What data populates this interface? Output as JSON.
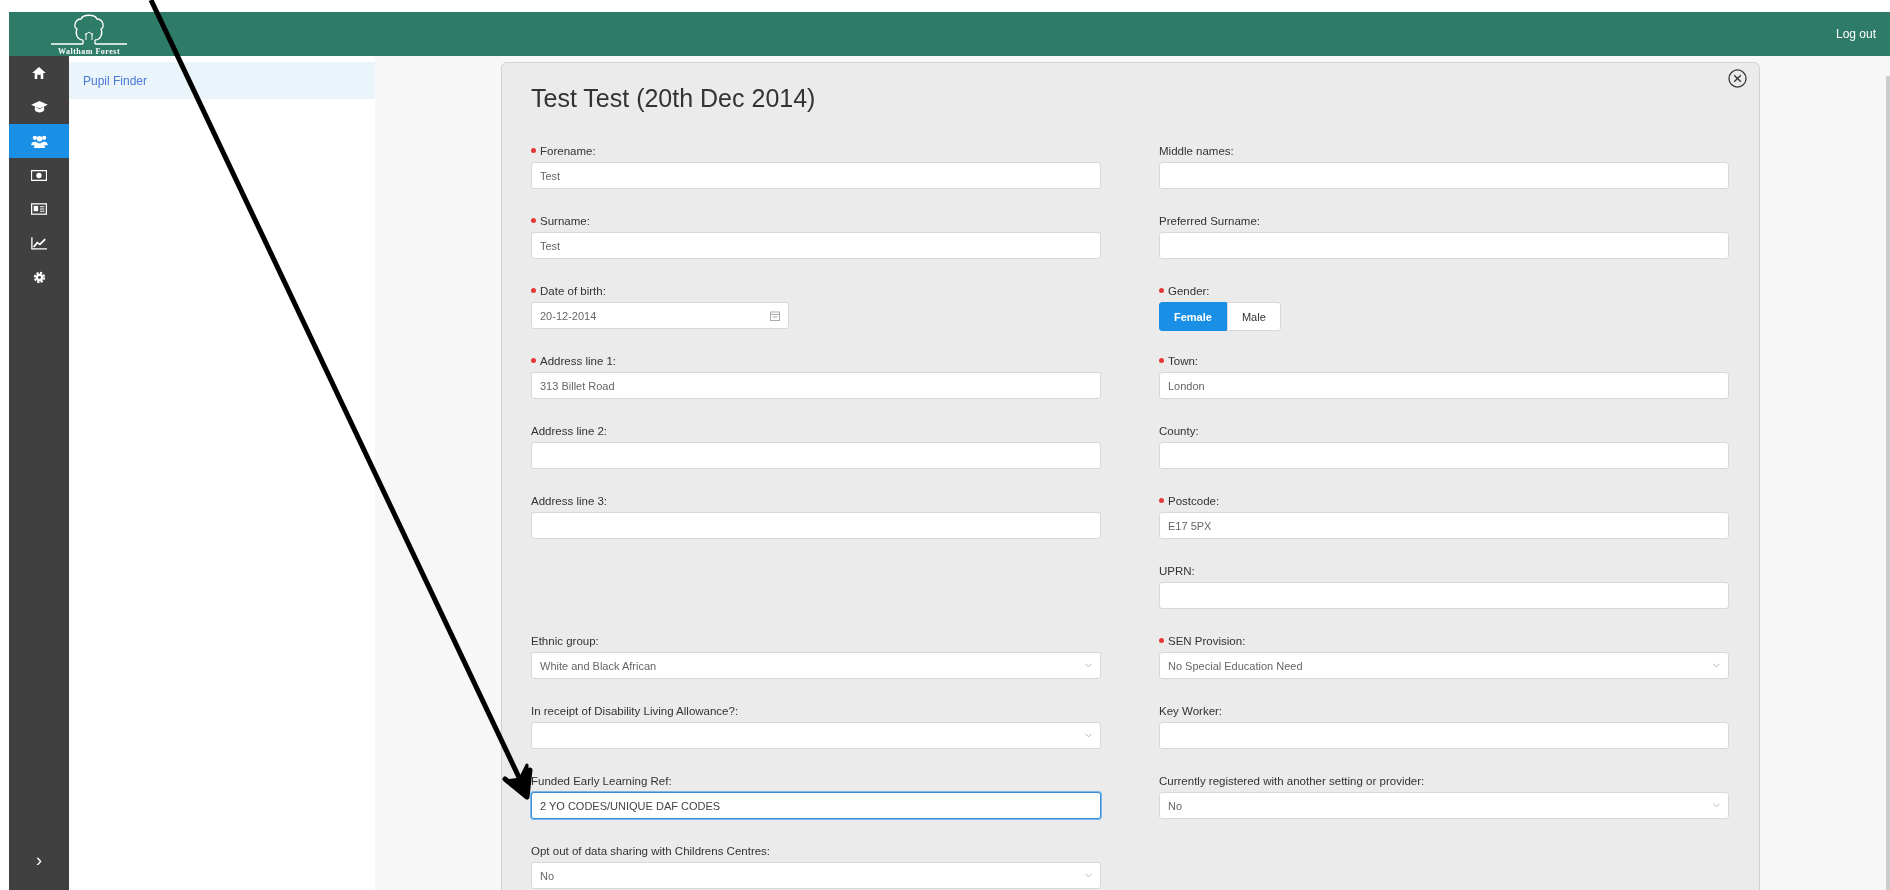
{
  "header": {
    "logo_text": "Waltham Forest",
    "logout": "Log out"
  },
  "sidebar": {
    "items": [
      {
        "selected": false
      },
      {
        "selected": false
      },
      {
        "selected": true
      },
      {
        "selected": false
      },
      {
        "selected": false
      },
      {
        "selected": false
      },
      {
        "selected": false
      }
    ],
    "expand": "›"
  },
  "submenu": {
    "items": [
      {
        "label": "Pupil Finder",
        "selected": true
      }
    ]
  },
  "modal": {
    "title": "Test Test (20th Dec 2014)",
    "rows": [
      [
        {
          "kind": "text",
          "label": "Forename:",
          "required": true,
          "value": "Test",
          "focused": false
        },
        {
          "kind": "text",
          "label": "Middle names:",
          "required": false,
          "focused": false
        }
      ],
      [
        {
          "kind": "text",
          "label": "Surname:",
          "required": true,
          "value": "Test",
          "focused": false
        },
        {
          "kind": "text",
          "label": "Preferred Surname:",
          "required": false,
          "focused": false
        }
      ],
      [
        {
          "kind": "date",
          "label": "Date of birth:",
          "required": true,
          "value": "20-12-2014"
        },
        {
          "kind": "toggle",
          "label": "Gender:",
          "required": true,
          "options": [
            {
              "label": "Female",
              "selected": true
            },
            {
              "label": "Male",
              "selected": false
            }
          ]
        }
      ],
      [
        {
          "kind": "text",
          "label": "Address line 1:",
          "required": true,
          "value": "313 Billet Road",
          "focused": false
        },
        {
          "kind": "text",
          "label": "Town:",
          "required": true,
          "value": "London",
          "focused": false
        }
      ],
      [
        {
          "kind": "text",
          "label": "Address line 2:",
          "required": false,
          "focused": false
        },
        {
          "kind": "text",
          "label": "County:",
          "required": false,
          "focused": false
        }
      ],
      [
        {
          "kind": "text",
          "label": "Address line 3:",
          "required": false,
          "focused": false
        },
        {
          "kind": "text",
          "label": "Postcode:",
          "required": true,
          "value": "E17 5PX",
          "focused": false
        }
      ],
      [
        {
          "kind": "empty"
        },
        {
          "kind": "text",
          "label": "UPRN:",
          "required": false,
          "focused": false
        }
      ],
      [
        {
          "kind": "select",
          "label": "Ethnic group:",
          "required": false,
          "value": "White and Black African"
        },
        {
          "kind": "select",
          "label": "SEN Provision:",
          "required": true,
          "value": "No Special Education Need"
        }
      ],
      [
        {
          "kind": "select",
          "label": "In receipt of Disability Living Allowance?:",
          "required": false
        },
        {
          "kind": "text",
          "label": "Key Worker:",
          "required": false,
          "focused": false
        }
      ],
      [
        {
          "kind": "text",
          "label": "Funded Early Learning Ref:",
          "required": false,
          "value": "2 YO CODES/UNIQUE DAF CODES",
          "focused": true
        },
        {
          "kind": "select",
          "label": "Currently registered with another setting or provider:",
          "required": false,
          "value": "No"
        }
      ],
      [
        {
          "kind": "select",
          "label": "Opt out of data sharing with Childrens Centres:",
          "required": false,
          "value": "No"
        },
        {
          "kind": "empty"
        }
      ]
    ]
  }
}
